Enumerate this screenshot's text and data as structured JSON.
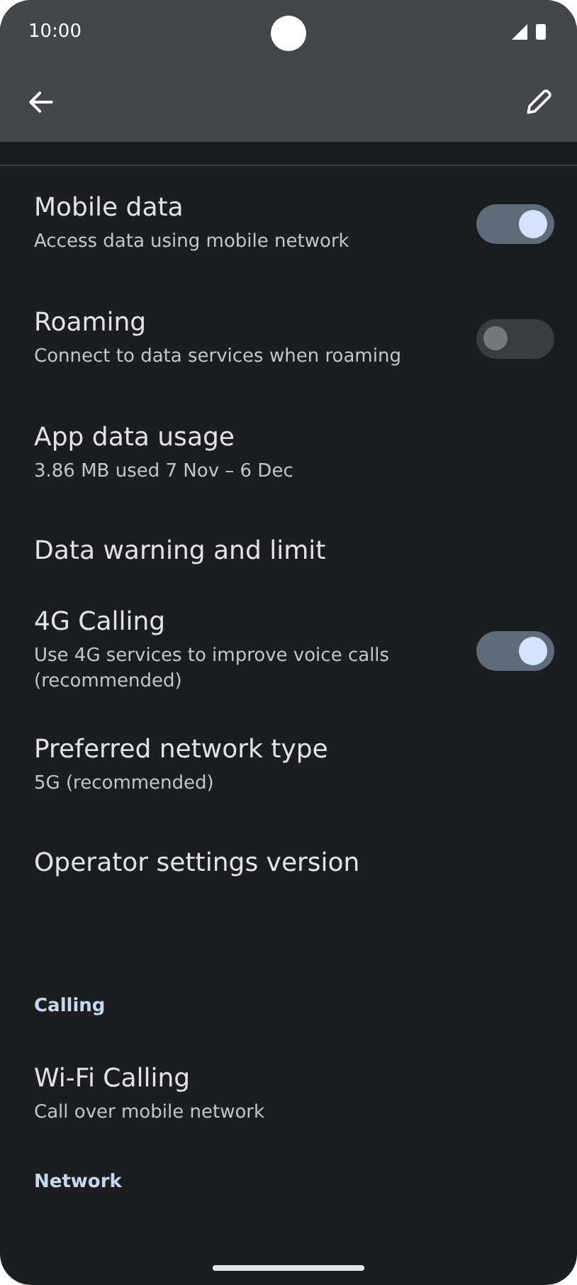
{
  "status_bar": {
    "time": "10:00"
  },
  "items": [
    {
      "kind": "toggle",
      "title": "Mobile data",
      "subtitle": "Access data using mobile network",
      "on": true
    },
    {
      "kind": "toggle",
      "title": "Roaming",
      "subtitle": "Connect to data services when roaming",
      "on": false
    },
    {
      "kind": "plain",
      "title": "App data usage",
      "subtitle": "3.86 MB used 7 Nov – 6 Dec"
    },
    {
      "kind": "plain",
      "title": "Data warning and limit"
    },
    {
      "kind": "toggle",
      "title": "4G Calling",
      "subtitle": "Use 4G services to improve voice calls (recommended)",
      "on": true
    },
    {
      "kind": "plain",
      "title": "Preferred network type",
      "subtitle": "5G (recommended)"
    },
    {
      "kind": "plain",
      "title": "Operator settings version"
    },
    {
      "kind": "header",
      "title": "Calling"
    },
    {
      "kind": "plain",
      "title": "Wi-Fi Calling",
      "subtitle": "Call over mobile network"
    },
    {
      "kind": "header",
      "title": "Network"
    }
  ]
}
